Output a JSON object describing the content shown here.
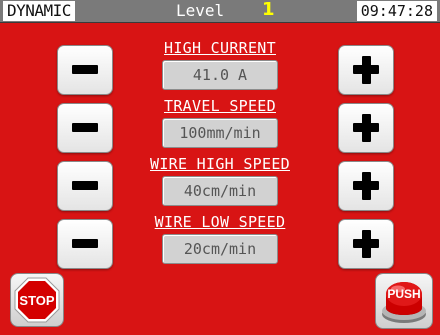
{
  "header": {
    "mode": "DYNAMIC",
    "level_label": "Level",
    "level_value": "1",
    "time": "09:47:28"
  },
  "params": [
    {
      "label": "HIGH CURRENT",
      "value": "41.0 A"
    },
    {
      "label": "TRAVEL SPEED",
      "value": "100mm/min"
    },
    {
      "label": "WIRE HIGH SPEED",
      "value": "40cm/min"
    },
    {
      "label": "WIRE LOW SPEED",
      "value": "20cm/min"
    }
  ],
  "footer": {
    "stop_label": "STOP",
    "push_label": "PUSH"
  },
  "colors": {
    "background": "#d81414",
    "header": "#7a7a7a",
    "level_value": "#ffff00",
    "stop_octagon": "#d40000",
    "push_button": "#cc0000"
  },
  "icons": {
    "decrement": "minus-icon",
    "increment": "plus-icon",
    "stop": "stop-sign-icon",
    "push": "push-button-icon"
  }
}
